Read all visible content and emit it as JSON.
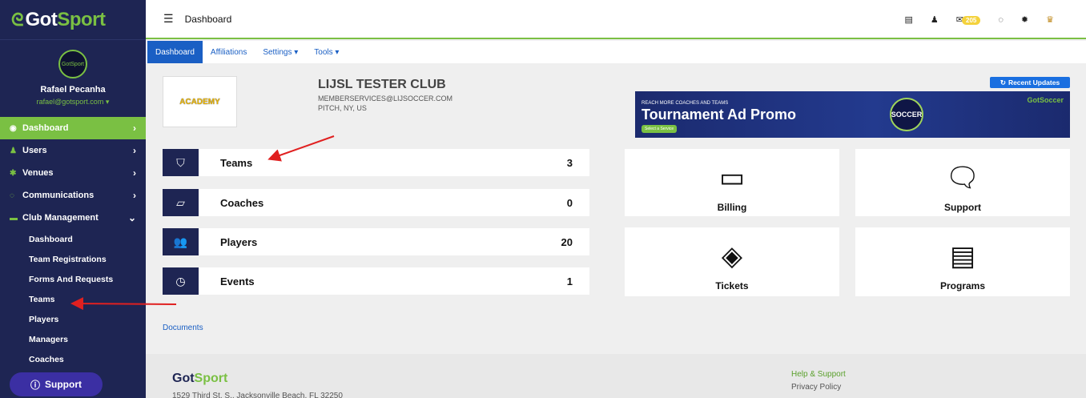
{
  "sidebar": {
    "logo": {
      "prefix": "Got",
      "suffix": "Sport"
    },
    "avatar_text": "GotSport",
    "profile": {
      "name": "Rafael Pecanha",
      "email": "rafael@gotsport.com ▾"
    },
    "nav": [
      {
        "label": "Dashboard",
        "active": true
      },
      {
        "label": "Users"
      },
      {
        "label": "Venues"
      },
      {
        "label": "Communications"
      },
      {
        "label": "Club Management"
      }
    ],
    "sub_items": [
      "Dashboard",
      "Team Registrations",
      "Forms And Requests",
      "Teams",
      "Players",
      "Managers",
      "Coaches"
    ],
    "support_label": "Support"
  },
  "header": {
    "title": "Dashboard",
    "mail_badge": "205"
  },
  "tabs": [
    {
      "label": "Dashboard",
      "active": true
    },
    {
      "label": "Affiliations"
    },
    {
      "label": "Settings ▾"
    },
    {
      "label": "Tools ▾"
    }
  ],
  "club": {
    "logo_text": "ACADEMY",
    "name": "LIJSL TESTER CLUB",
    "email": "MEMBERSERVICES@LIJSOCCER.COM",
    "location": "PITCH, NY, US"
  },
  "recent_updates": "Recent Updates",
  "promo": {
    "small": "REACH MORE COACHES AND TEAMS",
    "title": "Tournament Ad Promo",
    "cta": "Select a Service",
    "badge": "SOCCER",
    "brand": "GotSoccer"
  },
  "stats": [
    {
      "label": "Teams",
      "count": "3"
    },
    {
      "label": "Coaches",
      "count": "0"
    },
    {
      "label": "Players",
      "count": "20"
    },
    {
      "label": "Events",
      "count": "1"
    }
  ],
  "cards": [
    {
      "label": "Billing",
      "icon": "credit-card-icon"
    },
    {
      "label": "Support",
      "icon": "chat-icon"
    },
    {
      "label": "Tickets",
      "icon": "ticket-icon"
    },
    {
      "label": "Programs",
      "icon": "document-icon"
    }
  ],
  "documents_link": "Documents",
  "footer": {
    "logo_prefix": "Got",
    "logo_suffix": "Sport",
    "address": "1529 Third St. S., Jacksonville Beach, FL 32250",
    "help": "Help & Support",
    "privacy": "Privacy Policy"
  },
  "colors": {
    "navy": "#1e2553",
    "green": "#7ac043",
    "blue": "#1a5fc4",
    "arrow": "#e02020"
  }
}
